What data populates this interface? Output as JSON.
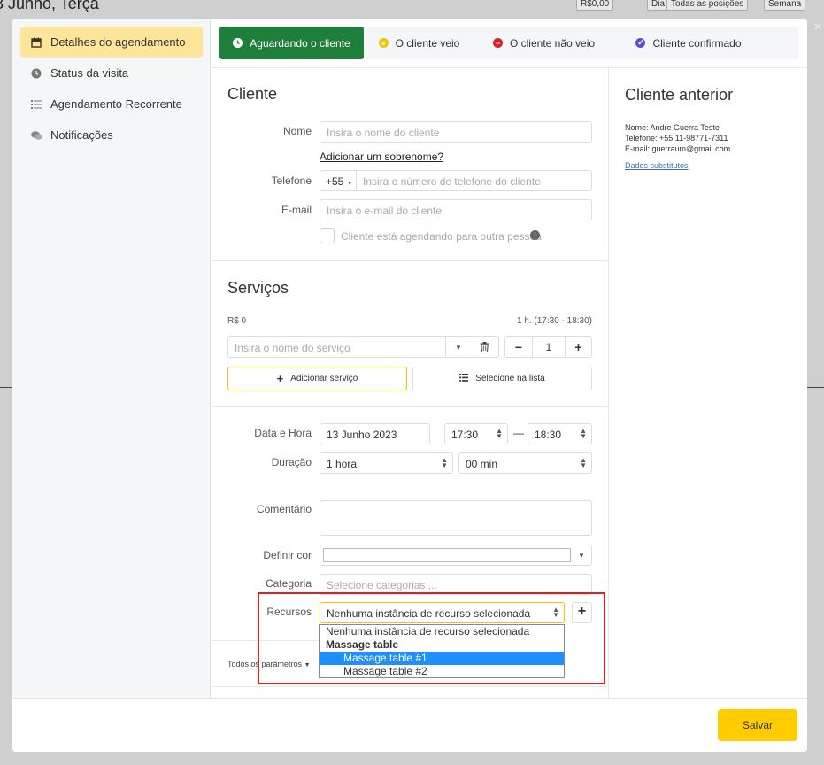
{
  "background": {
    "title": "3 Junho, Terça",
    "price_chip": "R$0,00",
    "view_day": "Dia",
    "positions": "Todas as posições",
    "view_week": "Semana"
  },
  "sidebar": {
    "items": [
      {
        "label": "Detalhes do agendamento",
        "icon": "calendar-icon"
      },
      {
        "label": "Status da visita",
        "icon": "clock-icon"
      },
      {
        "label": "Agendamento Recorrente",
        "icon": "list-icon"
      },
      {
        "label": "Notificações",
        "icon": "chat-icon"
      }
    ]
  },
  "status": {
    "tabs": [
      {
        "label": "Aguardando o cliente",
        "color": "#ffffff"
      },
      {
        "label": "O cliente veio",
        "color": "#f5c400"
      },
      {
        "label": "O cliente não veio",
        "color": "#e02020"
      },
      {
        "label": "Cliente confirmado",
        "color": "#5a4fd6"
      }
    ]
  },
  "client": {
    "title": "Cliente",
    "name_label": "Nome",
    "name_placeholder": "Insira o nome do cliente",
    "add_surname": "Adicionar um sobrenome?",
    "phone_label": "Telefone",
    "phone_code": "+55",
    "phone_placeholder": "Insira o número de telefone do cliente",
    "email_label": "E-mail",
    "email_placeholder": "Insira o e-mail do cliente",
    "other_person": "Cliente está agendando para outra pessoa"
  },
  "services": {
    "title": "Serviços",
    "price": "R$ 0",
    "time": "1 h. (17:30 - 18:30)",
    "service_placeholder": "Insira o nome do serviço",
    "quantity": "1",
    "minus": "−",
    "plus": "+",
    "add_service": "Adicionar serviço",
    "select_list": "Selecione na lista"
  },
  "details": {
    "datetime_label": "Data e Hora",
    "date": "13 Junho 2023",
    "start": "17:30",
    "dash": "—",
    "end": "18:30",
    "duration_label": "Duração",
    "hours": "1 hora",
    "minutes": "00 min",
    "comment_label": "Comentário",
    "color_label": "Definir cor",
    "category_label": "Categoria",
    "category_placeholder": "Selecione categorias ...",
    "resources_label": "Recursos",
    "resources_value": "Nenhuma instância de recurso selecionada",
    "all_params": "Todos os parâmetros",
    "dropdown": {
      "none": "Nenhuma instância de recurso selecionada",
      "group": "Massage table",
      "item1": "Massage table #1",
      "item2": "Massage table #2"
    }
  },
  "previous": {
    "title": "Cliente anterior",
    "name": "Nome: Andre Guerra Teste",
    "phone": "Telefone: +55 11-98771-7311",
    "email": "E-mail: guerraum@gmail.com",
    "substitute": "Dados substitutos"
  },
  "footer": {
    "save": "Salvar"
  }
}
